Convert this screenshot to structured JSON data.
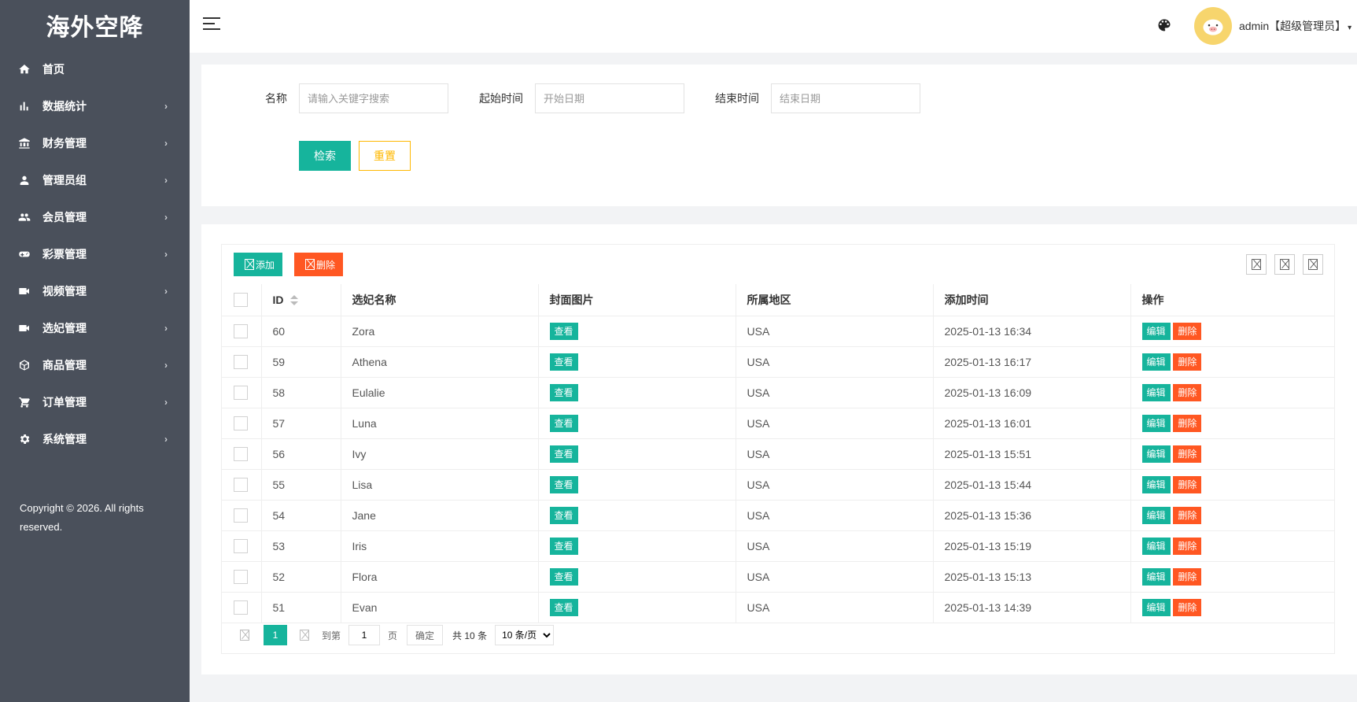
{
  "app": {
    "logo": "海外空降"
  },
  "sidebar": {
    "items": [
      {
        "label": "首页",
        "icon": "home-icon",
        "arrow": ""
      },
      {
        "label": "数据统计",
        "icon": "bar-chart-icon",
        "arrow": "›"
      },
      {
        "label": "财务管理",
        "icon": "bank-icon",
        "arrow": "›"
      },
      {
        "label": "管理员组",
        "icon": "person-icon",
        "arrow": "›"
      },
      {
        "label": "会员管理",
        "icon": "group-icon",
        "arrow": "›"
      },
      {
        "label": "彩票管理",
        "icon": "gamepad-icon",
        "arrow": "›"
      },
      {
        "label": "视频管理",
        "icon": "video-camera-icon",
        "arrow": "›"
      },
      {
        "label": "选妃管理",
        "icon": "video-camera-icon",
        "arrow": "›"
      },
      {
        "label": "商品管理",
        "icon": "box-icon",
        "arrow": "›"
      },
      {
        "label": "订单管理",
        "icon": "cart-icon",
        "arrow": "›"
      },
      {
        "label": "系统管理",
        "icon": "gear-icon",
        "arrow": "›"
      }
    ],
    "copyright": "Copyright © 2026. All rights reserved."
  },
  "header": {
    "username": "admin【超级管理员】",
    "caret": "▾"
  },
  "search": {
    "name_label": "名称",
    "name_placeholder": "请输入关键字搜索",
    "start_label": "起始时间",
    "start_placeholder": "开始日期",
    "end_label": "结束时间",
    "end_placeholder": "结束日期",
    "search_btn": "检索",
    "reset_btn": "重置"
  },
  "toolbar": {
    "add": "添加",
    "delete": "删除"
  },
  "table": {
    "headers": {
      "id": "ID",
      "name": "选妃名称",
      "cover": "封面图片",
      "region": "所属地区",
      "time": "添加时间",
      "ops": "操作"
    },
    "view_label": "查看",
    "edit_label": "编辑",
    "delete_label": "删除",
    "rows": [
      {
        "id": "60",
        "name": "Zora",
        "region": "USA",
        "time": "2025-01-13 16:34"
      },
      {
        "id": "59",
        "name": "Athena",
        "region": "USA",
        "time": "2025-01-13 16:17"
      },
      {
        "id": "58",
        "name": "Eulalie",
        "region": "USA",
        "time": "2025-01-13 16:09"
      },
      {
        "id": "57",
        "name": "Luna",
        "region": "USA",
        "time": "2025-01-13 16:01"
      },
      {
        "id": "56",
        "name": "Ivy",
        "region": "USA",
        "time": "2025-01-13 15:51"
      },
      {
        "id": "55",
        "name": "Lisa",
        "region": "USA",
        "time": "2025-01-13 15:44"
      },
      {
        "id": "54",
        "name": "Jane",
        "region": "USA",
        "time": "2025-01-13 15:36"
      },
      {
        "id": "53",
        "name": "Iris",
        "region": "USA",
        "time": "2025-01-13 15:19"
      },
      {
        "id": "52",
        "name": "Flora",
        "region": "USA",
        "time": "2025-01-13 15:13"
      },
      {
        "id": "51",
        "name": "Evan",
        "region": "USA",
        "time": "2025-01-13 14:39"
      }
    ]
  },
  "pagination": {
    "current": "1",
    "goto_label": "到第",
    "goto_value": "1",
    "page_unit": "页",
    "confirm": "确定",
    "total": "共 10 条",
    "per_page": "10 条/页"
  },
  "colors": {
    "primary": "#16b49c",
    "danger": "#ff5722",
    "warning": "#ffb800",
    "sidebar": "#4a505b"
  }
}
